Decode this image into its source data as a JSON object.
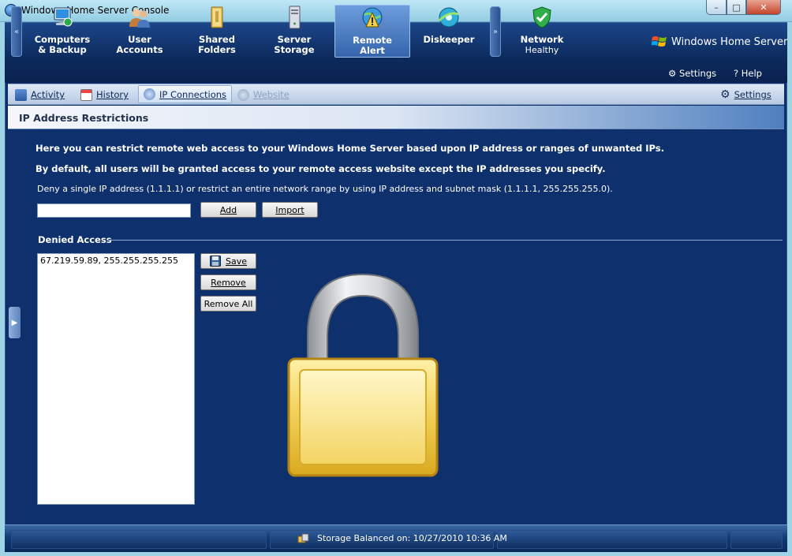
{
  "window": {
    "title": "Windows Home Server Console",
    "controls": {
      "minimize": "–",
      "maximize": "□",
      "close": "✕"
    }
  },
  "nav": {
    "scroll_left": "«",
    "scroll_right": "»",
    "items": [
      {
        "line1": "Computers",
        "line2": "& Backup",
        "icon": "computer-icon"
      },
      {
        "line1": "User",
        "line2": "Accounts",
        "icon": "users-icon"
      },
      {
        "line1": "Shared",
        "line2": "Folders",
        "icon": "folder-icon"
      },
      {
        "line1": "Server",
        "line2": "Storage",
        "icon": "server-icon"
      },
      {
        "line1": "Remote",
        "line2": "Alert",
        "icon": "globe-alert-icon",
        "active": true
      },
      {
        "line1": "Diskeeper",
        "line2": "",
        "icon": "diskeeper-icon"
      },
      {
        "line1": "Network",
        "line2": "Healthy",
        "icon": "shield-check-icon"
      }
    ],
    "brand": "Windows Home Server",
    "settings_label": "Settings",
    "help_label": "Help"
  },
  "subtabs": {
    "items": [
      {
        "label": "Activity",
        "icon": "activity-icon"
      },
      {
        "label": "History",
        "icon": "calendar-icon"
      },
      {
        "label": "IP Connections",
        "icon": "ip-icon",
        "active": true
      },
      {
        "label": "Website",
        "icon": "website-icon",
        "disabled": true
      }
    ],
    "settings_label": "Settings"
  },
  "section": {
    "title": "IP Address Restrictions",
    "intro1": "Here you can restrict remote web access to your Windows Home Server based upon IP address or ranges of unwanted IPs.",
    "intro2": "By default, all users will be granted access to your remote access website except the IP addresses you specify.",
    "hint": "Deny a single IP address (1.1.1.1) or restrict an entire network range by using IP address and subnet mask (1.1.1.1, 255.255.255.0).",
    "input_value": "",
    "add_label": "Add",
    "import_label": "Import",
    "denied_label": "Denied Access",
    "denied_entries": [
      "67.219.59.89, 255.255.255.255"
    ],
    "save_label": "Save",
    "remove_label": "Remove",
    "remove_all_label": "Remove All"
  },
  "status": {
    "text": "Storage Balanced on: 10/27/2010 10:36 AM"
  },
  "colors": {
    "content_bg": "#0e306d",
    "nav_bg": "#0c2a5c",
    "accent": "#3564ab",
    "lock_gold": "#f2c94c"
  }
}
